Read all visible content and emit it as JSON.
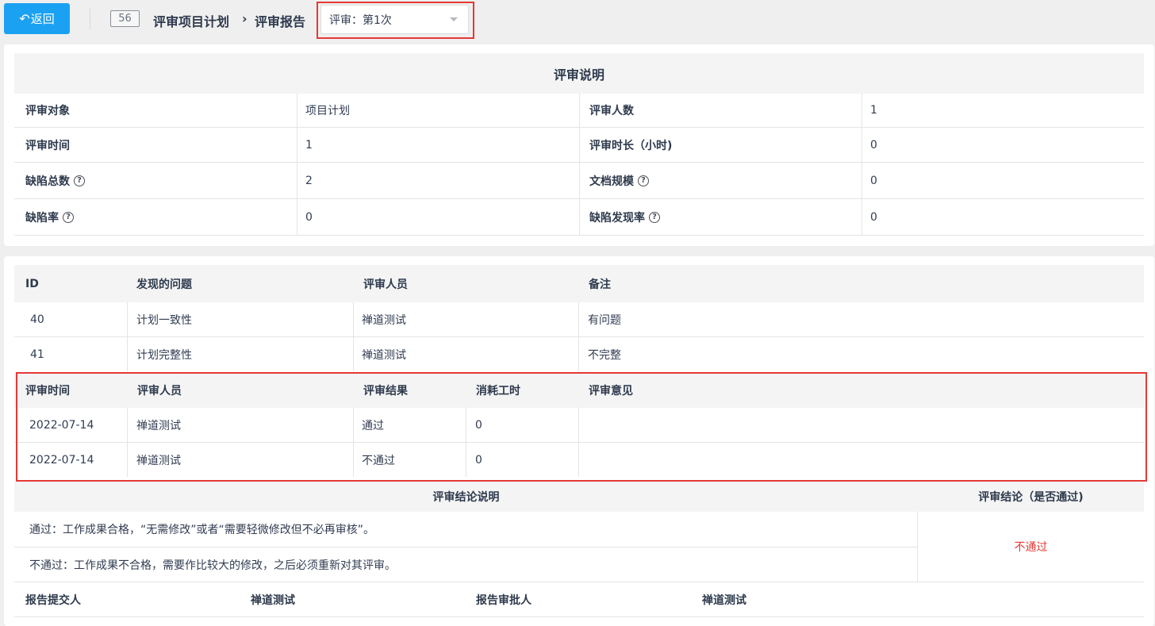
{
  "topbar": {
    "back_label": "返回",
    "back_icon": "undo-arrow-icon",
    "id_badge": "56",
    "breadcrumb_1": "评审项目计划",
    "breadcrumb_sep": "›",
    "breadcrumb_2": "评审报告",
    "review_select_value": "评审：第1次"
  },
  "review_info": {
    "title": "评审说明",
    "rows": [
      {
        "l1": "评审对象",
        "v1": "项目计划",
        "l2": "评审人数",
        "v2": "1"
      },
      {
        "l1": "评审时间",
        "v1": "1",
        "l2": "评审时长（小时)",
        "v2": "0"
      },
      {
        "l1": "缺陷总数",
        "v1": "2",
        "l2": "文档规模",
        "v2": "0"
      },
      {
        "l1": "缺陷率",
        "v1": "0",
        "l2": "缺陷发现率",
        "v2": "0"
      }
    ],
    "help_icon_glyph": "?"
  },
  "issues": {
    "headers": {
      "id": "ID",
      "issue": "发现的问题",
      "reviewer": "评审人员",
      "note": "备注"
    },
    "rows": [
      {
        "id": "40",
        "issue": "计划一致性",
        "reviewer": "禅道测试",
        "note": "有问题"
      },
      {
        "id": "41",
        "issue": "计划完整性",
        "reviewer": "禅道测试",
        "note": "不完整"
      }
    ]
  },
  "results": {
    "headers": {
      "time": "评审时间",
      "reviewer": "评审人员",
      "result": "评审结果",
      "hours": "消耗工时",
      "opinion": "评审意见"
    },
    "rows": [
      {
        "time": "2022-07-14",
        "reviewer": "禅道测试",
        "result": "通过",
        "hours": "0",
        "opinion": ""
      },
      {
        "time": "2022-07-14",
        "reviewer": "禅道测试",
        "result": "不通过",
        "hours": "0",
        "opinion": ""
      }
    ]
  },
  "conclusion": {
    "desc_header": "评审结论说明",
    "verdict_header": "评审结论（是否通过)",
    "pass_desc": "通过：工作成果合格，“无需修改”或者“需要轻微修改但不必再审核”。",
    "fail_desc": "不通过：工作成果不合格，需要作比较大的修改，之后必须重新对其评审。",
    "verdict": "不通过"
  },
  "footer": {
    "submitter_label": "报告提交人",
    "submitter": "禅道测试",
    "approver_label": "报告审批人",
    "approver": "禅道测试"
  },
  "colors": {
    "accent": "#1ba1f2",
    "highlight": "#e53935",
    "fail": "#e53935"
  }
}
